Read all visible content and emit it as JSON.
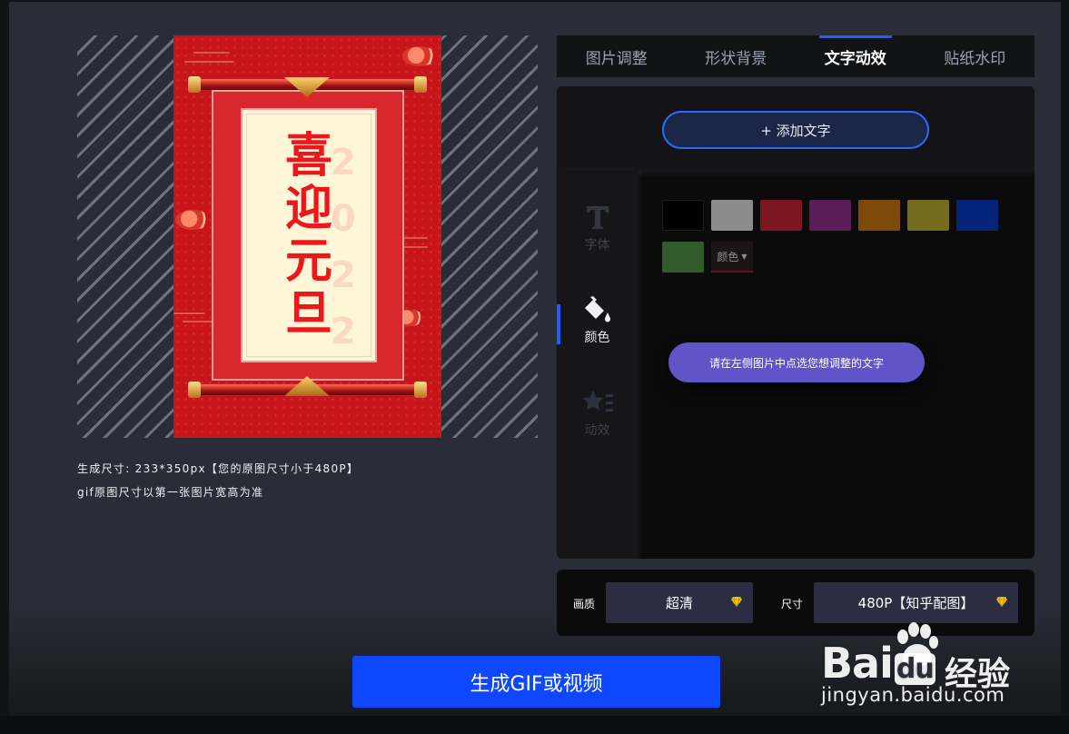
{
  "tabs": [
    {
      "label": "图片调整",
      "active": false
    },
    {
      "label": "形状背景",
      "active": false
    },
    {
      "label": "文字动效",
      "active": true
    },
    {
      "label": "贴纸水印",
      "active": false
    }
  ],
  "preview": {
    "poster_title_chars": [
      "喜",
      "迎",
      "元",
      "旦"
    ],
    "poster_ghost_digits": [
      "2",
      "0",
      "2",
      "2"
    ],
    "size_info": "生成尺寸: 233*350px【您的原图尺寸小于480P】",
    "gif_note": "gif原图尺寸以第一张图片宽高为准"
  },
  "editor": {
    "add_text_button": "+ 添加文字",
    "sidebar": [
      {
        "label": "字体",
        "icon": "font-t-icon",
        "active": false
      },
      {
        "label": "颜色",
        "icon": "paint-bucket-icon",
        "active": true
      },
      {
        "label": "动效",
        "icon": "star-list-icon",
        "active": false
      }
    ],
    "swatches": [
      "#000000",
      "#8c8c8c",
      "#7c1620",
      "#5a1d58",
      "#7e4a0c",
      "#736b1e",
      "#06237a",
      "#335a2a"
    ],
    "color_picker_label": "颜色",
    "hint": "请在左侧图片中点选您想调整的文字"
  },
  "output": {
    "quality_label": "画质",
    "quality_value": "超清",
    "size_label": "尺寸",
    "size_value": "480P【知乎配图】",
    "premium_color": "#f5c518"
  },
  "generate_button": "生成GIF或视频",
  "watermark": {
    "brand": "Bai",
    "brand_du": "du",
    "brand_cn": "经验",
    "url": "jingyan.baidu.com"
  },
  "accent": "#1e5cff"
}
